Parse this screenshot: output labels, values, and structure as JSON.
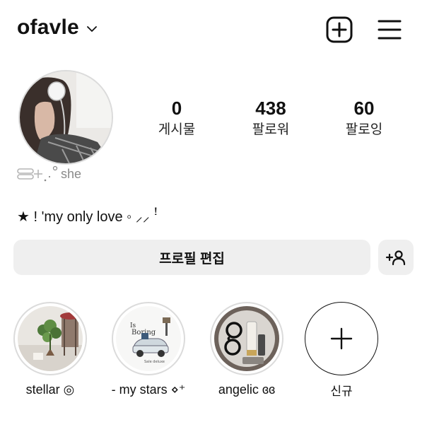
{
  "header": {
    "username": "ofavle",
    "icons": {
      "dropdown": "chevron-down-icon",
      "create": "plus-square-icon",
      "menu": "hamburger-menu-icon"
    }
  },
  "profile": {
    "pronoun_text": "she",
    "bio": "★ ! 'my only love ◦ ⸝⸝ ꜝ",
    "stats": [
      {
        "value": "0",
        "label": "게시물"
      },
      {
        "value": "438",
        "label": "팔로워"
      },
      {
        "value": "60",
        "label": "팔로잉"
      }
    ]
  },
  "actions": {
    "edit_profile": "프로필 편집",
    "add_person_icon": "add-person-icon"
  },
  "highlights": [
    {
      "label": "stellar ◎"
    },
    {
      "label": "- my stars ⋄⁺"
    },
    {
      "label": "angelic ɞɞ"
    }
  ],
  "new_highlight": {
    "label": "신규"
  },
  "colors": {
    "button_bg": "#efefef",
    "ring": "#dbdbdb",
    "text": "#111111",
    "muted": "#8a8a8a"
  }
}
